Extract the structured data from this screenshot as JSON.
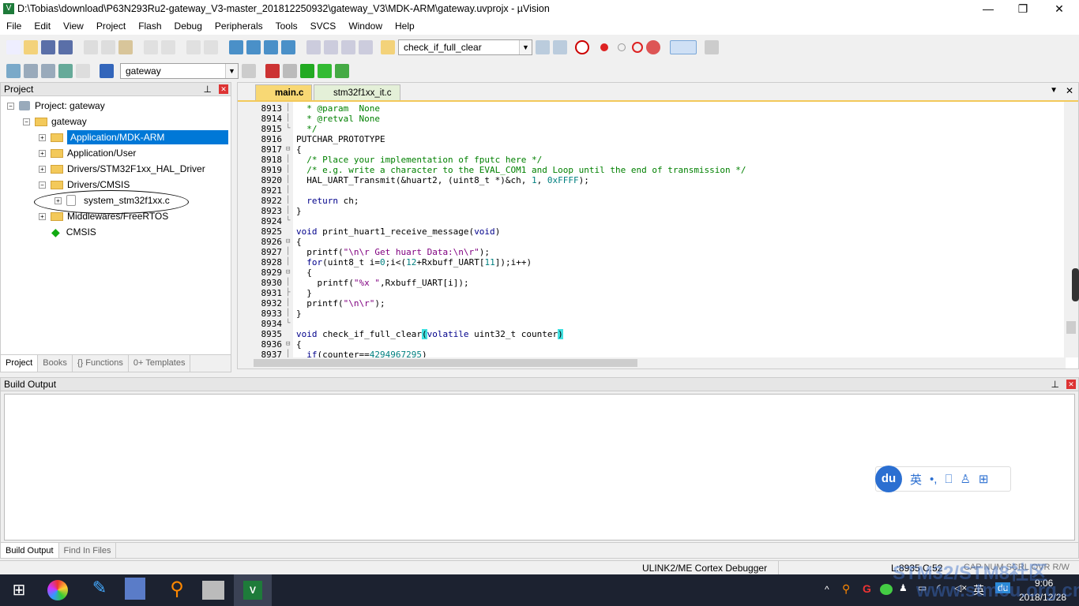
{
  "window": {
    "title": "D:\\Tobias\\download\\P63N293Ru2-gateway_V3-master_201812250932\\gateway_V3\\MDK-ARM\\gateway.uvprojx - µVision",
    "minimize": "—",
    "maximize": "❐",
    "close": "✕"
  },
  "menu": [
    "File",
    "Edit",
    "View",
    "Project",
    "Flash",
    "Debug",
    "Peripherals",
    "Tools",
    "SVCS",
    "Window",
    "Help"
  ],
  "toolbar": {
    "function_select": "check_if_full_clear",
    "target_select": "gateway"
  },
  "project": {
    "title": "Project",
    "root": "Project: gateway",
    "target": "gateway",
    "items": [
      "Application/MDK-ARM",
      "Application/User",
      "Drivers/STM32F1xx_HAL_Driver",
      "Drivers/CMSIS",
      "system_stm32f1xx.c",
      "Middlewares/FreeRTOS",
      "CMSIS"
    ],
    "tabs": [
      "Project",
      "Books",
      "{} Functions",
      "0+ Templates"
    ]
  },
  "editor": {
    "tabs": [
      "main.c",
      "stm32f1xx_it.c"
    ],
    "lines": [
      {
        "n": "8913",
        "f": "│",
        "t": [
          [
            "  * @param  None",
            "c-cm"
          ]
        ]
      },
      {
        "n": "8914",
        "f": "│",
        "t": [
          [
            "  * @retval None",
            "c-cm"
          ]
        ]
      },
      {
        "n": "8915",
        "f": "└",
        "t": [
          [
            "  */",
            "c-cm"
          ]
        ]
      },
      {
        "n": "8916",
        "f": "",
        "t": [
          [
            "PUTCHAR_PROTOTYPE",
            ""
          ]
        ]
      },
      {
        "n": "8917",
        "f": "⊟",
        "t": [
          [
            "{",
            ""
          ]
        ]
      },
      {
        "n": "8918",
        "f": "│",
        "t": [
          [
            "  /* Place your implementation of fputc here */",
            "c-cm"
          ]
        ]
      },
      {
        "n": "8919",
        "f": "│",
        "t": [
          [
            "  /* e.g. write a character to the EVAL_COM1 and Loop until the end of transmission */",
            "c-cm"
          ]
        ]
      },
      {
        "n": "8920",
        "f": "│",
        "t": [
          [
            "  HAL_UART_Transmit(&huart2, (uint8_t *)&ch, ",
            ""
          ],
          [
            "1",
            "c-num"
          ],
          [
            ", ",
            ""
          ],
          [
            "0xFFFF",
            "c-num"
          ],
          [
            ");",
            ""
          ]
        ]
      },
      {
        "n": "8921",
        "f": "│",
        "t": [
          [
            "",
            ""
          ]
        ]
      },
      {
        "n": "8922",
        "f": "│",
        "t": [
          [
            "  ",
            ""
          ],
          [
            "return",
            "c-kw"
          ],
          [
            " ch;",
            ""
          ]
        ]
      },
      {
        "n": "8923",
        "f": "│",
        "t": [
          [
            "}",
            ""
          ]
        ]
      },
      {
        "n": "8924",
        "f": "└",
        "t": [
          [
            "",
            ""
          ]
        ]
      },
      {
        "n": "8925",
        "f": "",
        "t": [
          [
            "void",
            "c-kw"
          ],
          [
            " print_huart1_receive_message(",
            ""
          ],
          [
            "void",
            "c-kw"
          ],
          [
            ")",
            ""
          ]
        ]
      },
      {
        "n": "8926",
        "f": "⊟",
        "t": [
          [
            "{",
            ""
          ]
        ]
      },
      {
        "n": "8927",
        "f": "│",
        "t": [
          [
            "  printf(",
            ""
          ],
          [
            "\"\\n\\r Get huart Data:\\n\\r\"",
            "c-str"
          ],
          [
            ");",
            ""
          ]
        ]
      },
      {
        "n": "8928",
        "f": "│",
        "t": [
          [
            "  ",
            ""
          ],
          [
            "for",
            "c-kw"
          ],
          [
            "(uint8_t i=",
            ""
          ],
          [
            "0",
            "c-num"
          ],
          [
            ";i<(",
            ""
          ],
          [
            "12",
            "c-num"
          ],
          [
            "+Rxbuff_UART[",
            ""
          ],
          [
            "11",
            "c-num"
          ],
          [
            "]);i++)",
            ""
          ]
        ]
      },
      {
        "n": "8929",
        "f": "⊟",
        "t": [
          [
            "  {",
            ""
          ]
        ]
      },
      {
        "n": "8930",
        "f": "│",
        "t": [
          [
            "    printf(",
            ""
          ],
          [
            "\"%x \"",
            "c-str"
          ],
          [
            ",Rxbuff_UART[i]);",
            ""
          ]
        ]
      },
      {
        "n": "8931",
        "f": "├",
        "t": [
          [
            "  }",
            ""
          ]
        ]
      },
      {
        "n": "8932",
        "f": "│",
        "t": [
          [
            "  printf(",
            ""
          ],
          [
            "\"\\n\\r\"",
            "c-str"
          ],
          [
            ");",
            ""
          ]
        ]
      },
      {
        "n": "8933",
        "f": "│",
        "t": [
          [
            "}",
            ""
          ]
        ]
      },
      {
        "n": "8934",
        "f": "└",
        "t": [
          [
            "",
            ""
          ]
        ]
      },
      {
        "n": "8935",
        "f": "",
        "t": [
          [
            "void",
            "c-kw"
          ],
          [
            " check_if_full_clear",
            ""
          ],
          [
            "(",
            "c-br"
          ],
          [
            "volatile",
            "c-kw"
          ],
          [
            " uint32_t counter",
            ""
          ],
          [
            ")",
            "c-br"
          ]
        ]
      },
      {
        "n": "8936",
        "f": "⊟",
        "t": [
          [
            "{",
            ""
          ]
        ]
      },
      {
        "n": "8937",
        "f": "│",
        "t": [
          [
            "  ",
            ""
          ],
          [
            "if",
            "c-kw"
          ],
          [
            "(counter==",
            ""
          ],
          [
            "4294967295",
            "c-num"
          ],
          [
            ")",
            ""
          ]
        ]
      }
    ]
  },
  "build": {
    "title": "Build Output",
    "tabs": [
      "Build Output",
      "Find In Files"
    ]
  },
  "status": {
    "debugger": "ULINK2/ME Cortex Debugger",
    "position": "L:8935 C:52",
    "flags": "CAP  NUM  SCRL  OVR  R/W"
  },
  "ime": {
    "logo": "du",
    "lang": "英",
    "items": [
      "•,",
      "⎕",
      "♙",
      "⊞"
    ]
  },
  "watermark": [
    "STM32/STM8社区",
    "www.stmcu.org.cn"
  ],
  "taskbar": {
    "time": "9:06",
    "date": "2018/12/28",
    "lang": "英",
    "tray": "du"
  }
}
